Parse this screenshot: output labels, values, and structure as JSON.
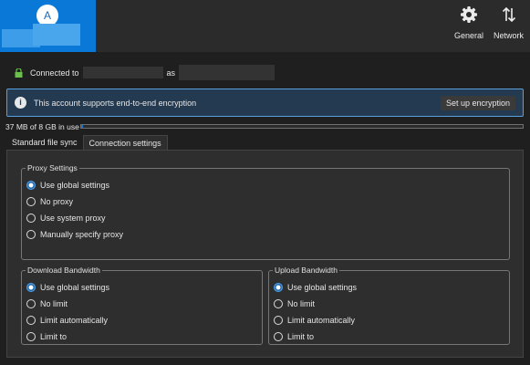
{
  "account": {
    "avatar_letter": "A"
  },
  "toolbar": {
    "general": "General",
    "network": "Network"
  },
  "connection": {
    "connected_to": "Connected to",
    "as": "as"
  },
  "banner": {
    "text": "This account supports end-to-end encryption",
    "button": "Set up encryption"
  },
  "usage": {
    "text": "37 MB of 8 GB in use",
    "fraction": 0.005
  },
  "tabs": [
    {
      "label": "Standard file sync",
      "active": false
    },
    {
      "label": "Connection settings",
      "active": true
    }
  ],
  "proxy": {
    "legend": "Proxy Settings",
    "options": [
      "Use global settings",
      "No proxy",
      "Use system proxy",
      "Manually specify proxy"
    ],
    "selected": 0
  },
  "download": {
    "legend": "Download Bandwidth",
    "options": [
      "Use global settings",
      "No limit",
      "Limit automatically",
      "Limit to"
    ],
    "selected": 0
  },
  "upload": {
    "legend": "Upload Bandwidth",
    "options": [
      "Use global settings",
      "No limit",
      "Limit automatically",
      "Limit to"
    ],
    "selected": 0
  },
  "colors": {
    "accent": "#0a78d6",
    "banner_bg": "#243a50",
    "banner_border": "#5aa0df"
  }
}
